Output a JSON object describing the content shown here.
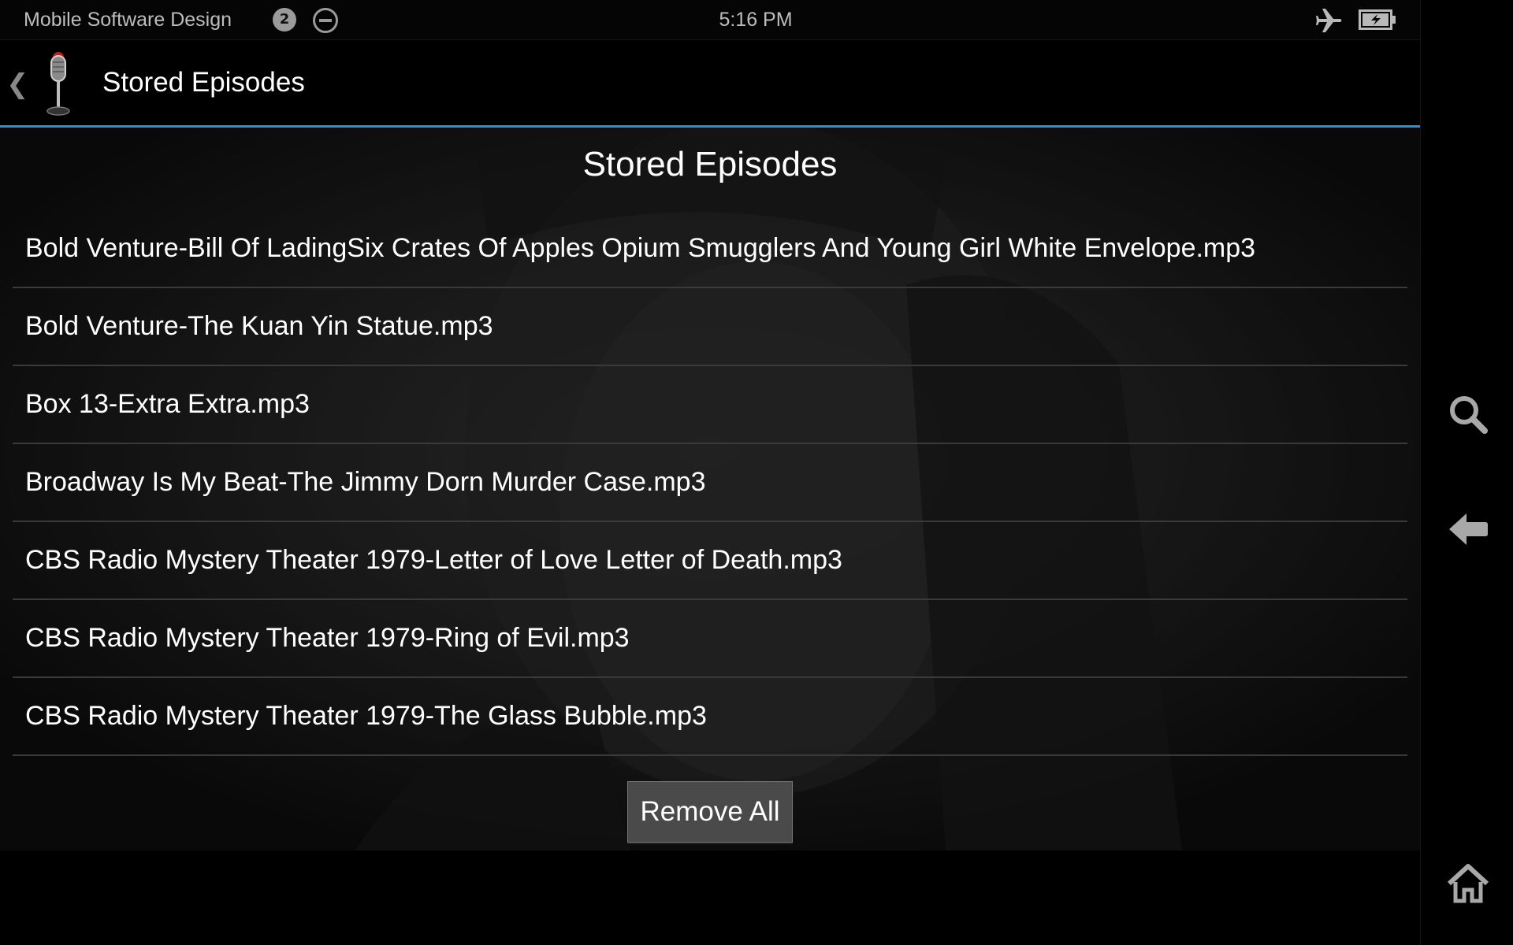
{
  "status_bar": {
    "app_name": "Mobile Software Design",
    "notification_count": "2",
    "time": "5:16 PM",
    "icons": [
      "notification-badge-icon",
      "do-not-disturb-icon",
      "airplane-mode-icon",
      "battery-charging-icon"
    ]
  },
  "action_bar": {
    "title": "Stored Episodes",
    "up_icon": "chevron-left-icon",
    "logo_icon": "microphone-icon",
    "accent_color": "#2f8fcf"
  },
  "main": {
    "heading": "Stored Episodes",
    "episodes": [
      "Bold Venture-Bill Of LadingSix Crates Of Apples Opium Smugglers And Young Girl White Envelope.mp3",
      "Bold Venture-The Kuan Yin Statue.mp3",
      "Box 13-Extra Extra.mp3",
      "Broadway Is My Beat-The Jimmy Dorn Murder Case.mp3",
      "CBS Radio Mystery Theater 1979-Letter of Love Letter of Death.mp3",
      "CBS Radio Mystery Theater 1979-Ring of Evil.mp3",
      "CBS Radio Mystery Theater 1979-The Glass Bubble.mp3"
    ],
    "remove_all_label": "Remove All"
  },
  "nav_bar": {
    "icons": [
      "search-icon",
      "back-arrow-icon",
      "home-icon"
    ]
  }
}
